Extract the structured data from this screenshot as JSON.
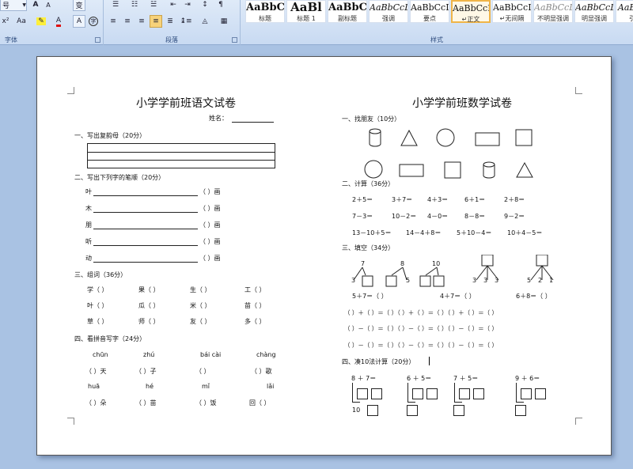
{
  "ribbon": {
    "font_size": "号",
    "font_group_label": "字体",
    "paragraph_group_label": "段落",
    "styles_group_label": "样式",
    "font_buttons": [
      "A",
      "A",
      "Aa",
      "A",
      "变",
      "A",
      "字"
    ],
    "style_cards": [
      {
        "sample": "AaBbC",
        "name": "标题"
      },
      {
        "sample": "AaBl",
        "name": "标题 1"
      },
      {
        "sample": "AaBbC",
        "name": "副标题"
      },
      {
        "sample": "AaBbCcDc",
        "name": "强调"
      },
      {
        "sample": "AaBbCcD",
        "name": "要点"
      },
      {
        "sample": "AaBbCcDc",
        "name": "↵正文"
      },
      {
        "sample": "AaBbCcDc",
        "name": "↵无间隔"
      },
      {
        "sample": "AaBbCcDc",
        "name": "不明显强调"
      },
      {
        "sample": "AaBbCcDc",
        "name": "明显强调"
      },
      {
        "sample": "AaBbCc",
        "name": "引用"
      }
    ]
  },
  "chinese": {
    "title": "小学学前班语文试卷",
    "name_label": "姓名：",
    "sec1": "一、写出复韵母（20分）",
    "sec2": "二、写出下列字的笔顺（20分）",
    "stroke_chars": [
      "叶",
      "木",
      "朋",
      "听",
      "动"
    ],
    "stroke_suffix": "（    ）画",
    "sec3": "三、组词（36分）",
    "word_rows": [
      [
        "学（      ）",
        "果（      ）",
        "生（      ）",
        "工（      ）"
      ],
      [
        "叶（      ）",
        "瓜（      ）",
        "米（      ）",
        "苗（      ）"
      ],
      [
        "草（      ）",
        "师（      ）",
        "友（      ）",
        "多（      ）"
      ]
    ],
    "sec4": "四、看拼音写字（24分）",
    "pinyin_row1": [
      "chūn",
      "zhú",
      "bái cài",
      "chàng"
    ],
    "blank_row1": [
      "（    ）天",
      "（    ）子",
      "（          ）",
      "（    ）歌"
    ],
    "pinyin_row2": [
      "huā",
      "hé",
      "mǐ",
      "lǎi"
    ],
    "blank_row2": [
      "（    ）朵",
      "（    ）苗",
      "（    ）饭",
      "回（    ）"
    ]
  },
  "math": {
    "title": "小学学前班数学试卷",
    "sec1": "一、找朋友（10分）",
    "sec2": "二、计算（36分）",
    "calc_rows": [
      [
        "2＋5＝",
        "3＋7＝",
        "4＋3＝",
        "6＋1＝",
        "2＋8＝"
      ],
      [
        "7－3＝",
        "10－2＝",
        "4－0＝",
        "8－8＝",
        "9－2＝"
      ],
      [
        "13－10＋5＝",
        "14－4＋8＝",
        "5＋10－4＝",
        "10＋4－5＝"
      ]
    ],
    "sec3": "三、填空（34分）",
    "tree_numbers": [
      "7",
      "3",
      "8",
      "5",
      "10",
      "3",
      "3",
      "3",
      "5",
      "2",
      "1"
    ],
    "eq_row1": [
      "5＋7＝（      ）",
      "4＋7＝（      ）",
      "6＋8＝（      ）"
    ],
    "eq_row2": "（    ）＋（    ）＝（    ）（    ）＋（    ）＝（    ）（    ）＋（    ）＝（    ）",
    "eq_row3": "（    ）－（    ）＝（    ）（    ）－（    ）＝（    ）（    ）－（    ）＝（    ）",
    "eq_row4": "（    ）－（    ）＝（    ）（    ）－（    ）＝（    ）（    ）－（    ）＝（    ）",
    "sec4": "四、凑10法计算（20分）",
    "make10": [
      "8 ＋ 7＝",
      "6 ＋ 5＝",
      "7 ＋ 5＝",
      "9 ＋ 6＝"
    ],
    "make10_answer": "10"
  }
}
